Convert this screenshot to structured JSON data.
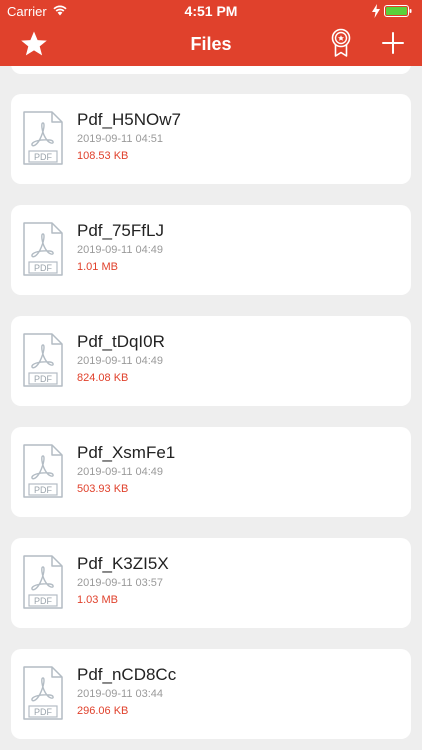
{
  "status_bar": {
    "carrier": "Carrier",
    "time": "4:51 PM"
  },
  "nav": {
    "title": "Files",
    "left_icon": "star-icon",
    "right_icons": [
      "award-icon",
      "plus-icon"
    ]
  },
  "colors": {
    "accent": "#e0412c",
    "background": "#eeeeee",
    "card": "#ffffff",
    "secondary_text": "#9a9a9a"
  },
  "file_icon_label": "PDF",
  "files": [
    {
      "name": "Pdf_H5NOw7",
      "date": "2019-09-11 04:51",
      "size": "108.53 KB"
    },
    {
      "name": "Pdf_75FfLJ",
      "date": "2019-09-11 04:49",
      "size": "1.01 MB"
    },
    {
      "name": "Pdf_tDqI0R",
      "date": "2019-09-11 04:49",
      "size": "824.08 KB"
    },
    {
      "name": "Pdf_XsmFe1",
      "date": "2019-09-11 04:49",
      "size": "503.93 KB"
    },
    {
      "name": "Pdf_K3ZI5X",
      "date": "2019-09-11 03:57",
      "size": "1.03 MB"
    },
    {
      "name": "Pdf_nCD8Cc",
      "date": "2019-09-11 03:44",
      "size": "296.06 KB"
    }
  ]
}
